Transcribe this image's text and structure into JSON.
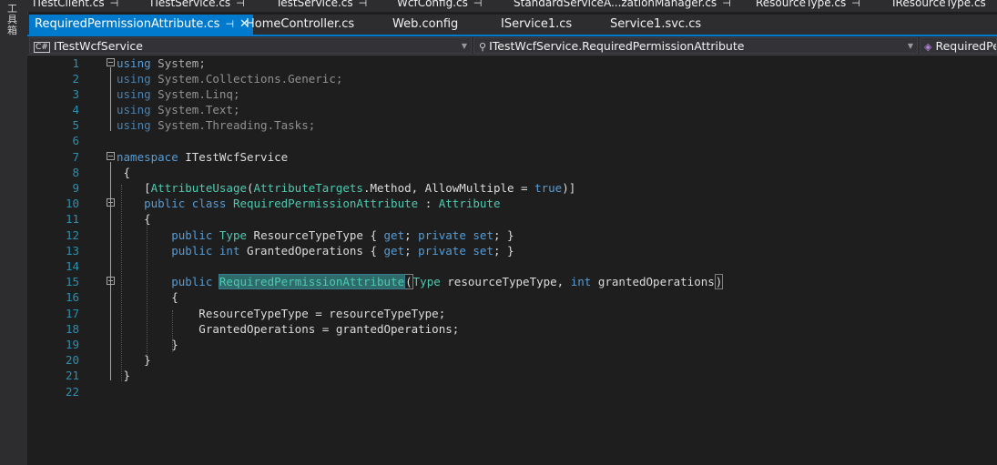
{
  "side": {
    "label": "工具箱"
  },
  "tabs_row1": [
    {
      "label": "ITestClient.cs"
    },
    {
      "label": "ITestService.cs"
    },
    {
      "label": "TestService.cs"
    },
    {
      "label": "WcfConfig.cs"
    },
    {
      "label": "StandardServiceA...zationManager.cs"
    },
    {
      "label": "ResourceType.cs"
    },
    {
      "label": "IResourceType.cs"
    }
  ],
  "tabs_row2": [
    {
      "label": "RequiredPermissionAttribute.cs",
      "active": true
    },
    {
      "label": "HomeController.cs"
    },
    {
      "label": "Web.config"
    },
    {
      "label": "IService1.cs"
    },
    {
      "label": "Service1.svc.cs"
    }
  ],
  "navbar": {
    "project": "ITestWcfService",
    "type": "ITestWcfService.RequiredPermissionAttribute",
    "member": "RequiredPe"
  },
  "code_lines": [
    {
      "n": "1",
      "text": "using System;"
    },
    {
      "n": "2",
      "text": "using System.Collections.Generic;"
    },
    {
      "n": "3",
      "text": "using System.Linq;"
    },
    {
      "n": "4",
      "text": "using System.Text;"
    },
    {
      "n": "5",
      "text": "using System.Threading.Tasks;"
    },
    {
      "n": "6",
      "text": ""
    },
    {
      "n": "7",
      "text": "namespace ITestWcfService"
    },
    {
      "n": "8",
      "text": "{"
    },
    {
      "n": "9",
      "text": "[AttributeUsage(AttributeTargets.Method, AllowMultiple = true)]"
    },
    {
      "n": "10",
      "text": "public class RequiredPermissionAttribute : Attribute"
    },
    {
      "n": "11",
      "text": "{"
    },
    {
      "n": "12",
      "text": "public Type ResourceTypeType { get; private set; }"
    },
    {
      "n": "13",
      "text": "public int GrantedOperations { get; private set; }"
    },
    {
      "n": "14",
      "text": ""
    },
    {
      "n": "15",
      "text": "public RequiredPermissionAttribute(Type resourceTypeType, int grantedOperations)"
    },
    {
      "n": "16",
      "text": "{"
    },
    {
      "n": "17",
      "text": "ResourceTypeType = resourceTypeType;"
    },
    {
      "n": "18",
      "text": "GrantedOperations = grantedOperations;"
    },
    {
      "n": "19",
      "text": "}"
    },
    {
      "n": "20",
      "text": "}"
    },
    {
      "n": "21",
      "text": "}"
    },
    {
      "n": "22",
      "text": ""
    }
  ],
  "colors": {
    "keyword": "#569cd6",
    "type": "#4ec9b0",
    "linenumber": "#2b91af",
    "accent": "#007acc",
    "background": "#1e1e1e"
  }
}
